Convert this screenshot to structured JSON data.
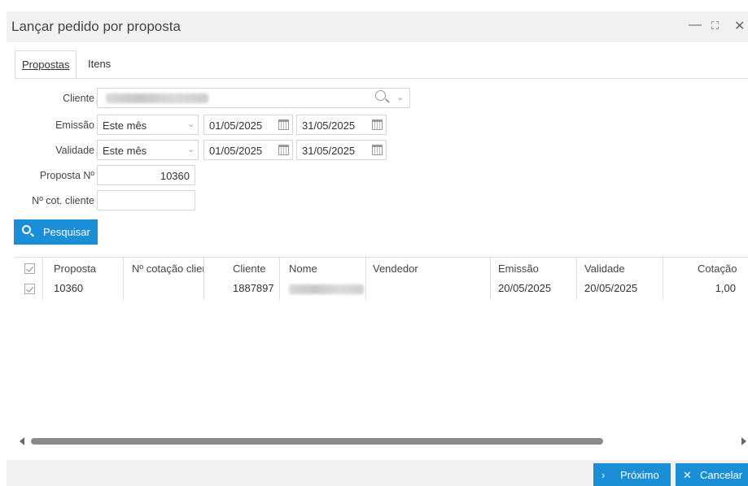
{
  "window": {
    "title": "Lançar pedido por proposta",
    "minimize": "—",
    "maximize": "⛶",
    "close": "✕"
  },
  "tabs": [
    "Propostas",
    "Itens"
  ],
  "form": {
    "cliente_label": "Cliente",
    "emissao_label": "Emissão",
    "emissao_period": "Este mês",
    "emissao_from": "01/05/2025",
    "emissao_to": "31/05/2025",
    "validade_label": "Validade",
    "validade_period": "Este mês",
    "validade_from": "01/05/2025",
    "validade_to": "31/05/2025",
    "proposta_label": "Proposta Nº",
    "proposta_value": "10360",
    "cot_label": "Nº cot. cliente",
    "cot_value": ""
  },
  "search_button": "Pesquisar",
  "grid": {
    "headers": [
      "Proposta",
      "Nº cotação clier",
      "Cliente",
      "Nome",
      "Vendedor",
      "Emissão",
      "Validade",
      "Cotação"
    ],
    "rows": [
      {
        "proposta": "10360",
        "cotacao_cliente": "",
        "cliente": "1887897",
        "vendedor": "",
        "emissao": "20/05/2025",
        "validade": "20/05/2025",
        "cotacao": "1,00"
      }
    ]
  },
  "footer": {
    "next": "Próximo",
    "next_icon": "chevron-right-icon",
    "cancel": "Cancelar",
    "cancel_icon": "close-icon"
  },
  "colors": {
    "accent": "#1a8fd8",
    "bar_bg": "#f2f2f2"
  }
}
